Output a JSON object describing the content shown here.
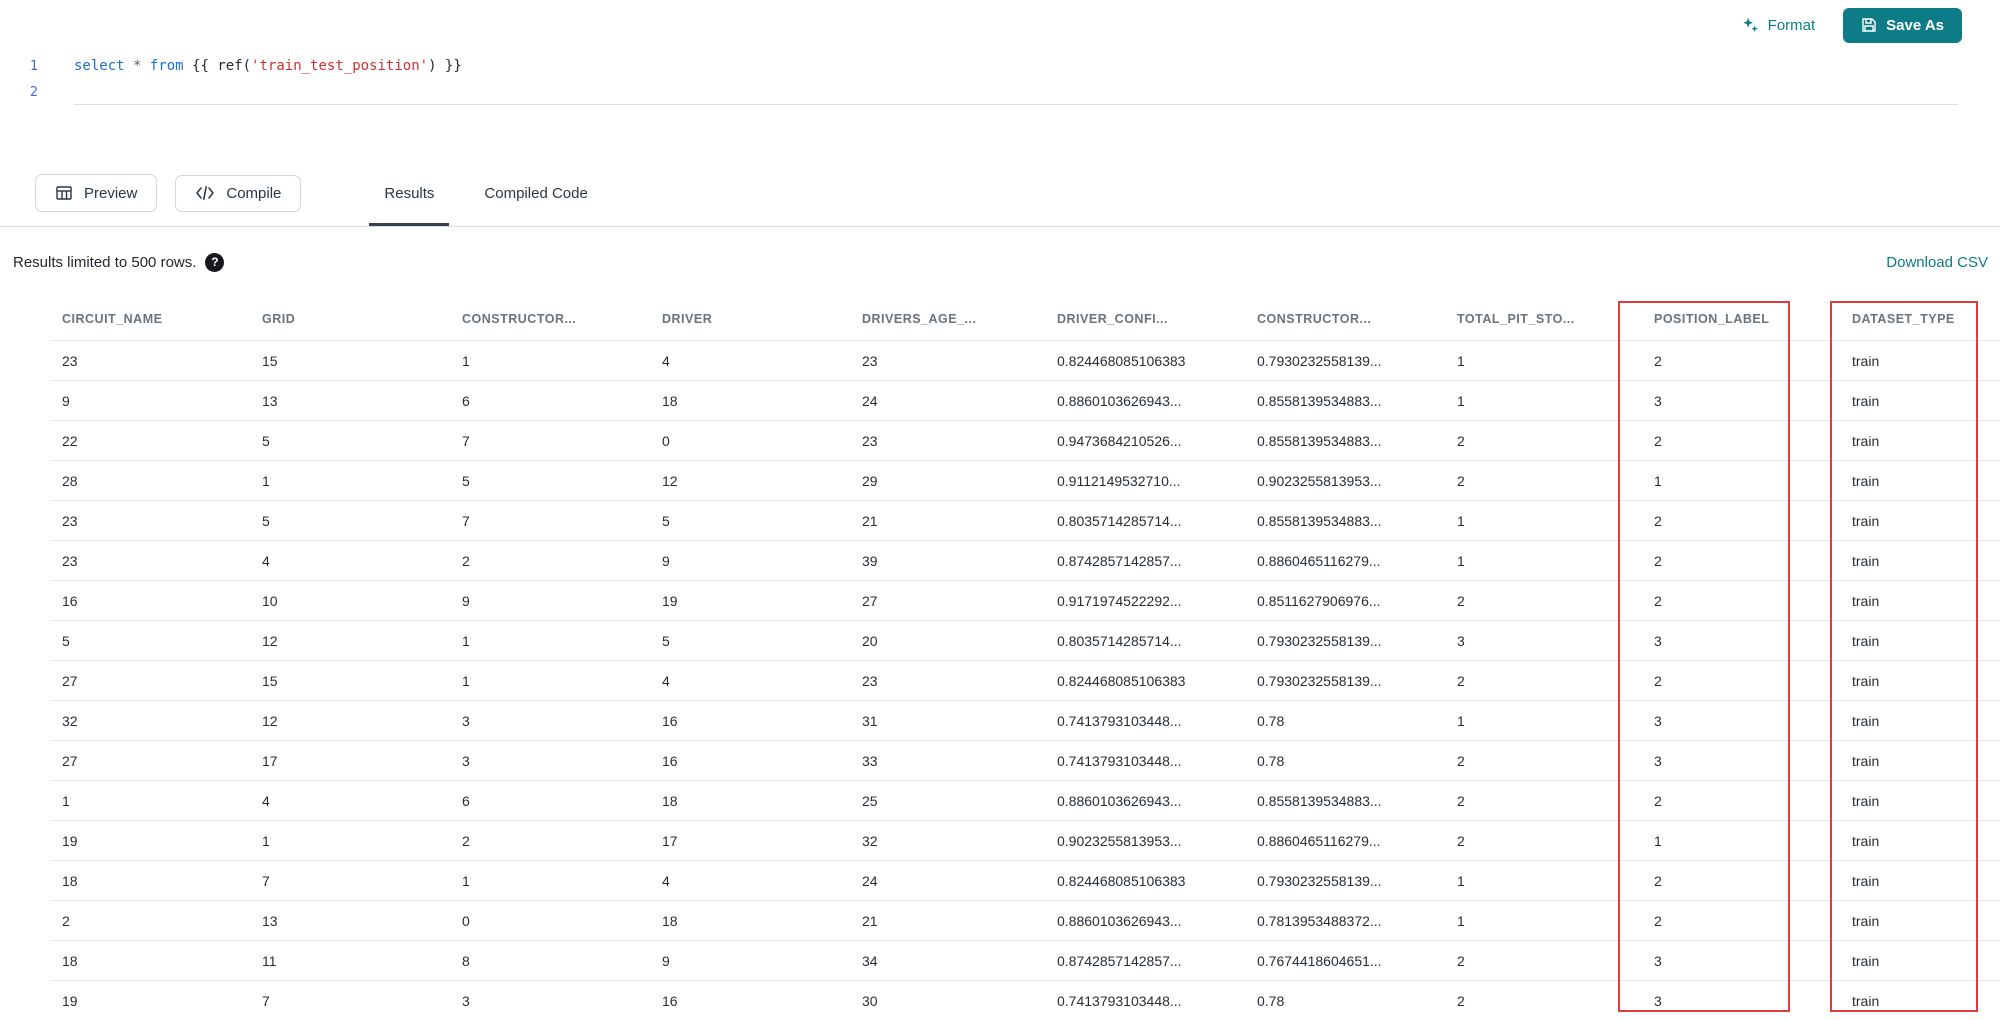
{
  "toolbar": {
    "format_label": "Format",
    "save_as_label": "Save As"
  },
  "editor": {
    "line_numbers": [
      "1",
      "2"
    ],
    "tokens": [
      {
        "text": "select",
        "type": "keyword"
      },
      {
        "text": " ",
        "type": "plain"
      },
      {
        "text": "*",
        "type": "operator"
      },
      {
        "text": " ",
        "type": "plain"
      },
      {
        "text": "from",
        "type": "keyword"
      },
      {
        "text": " {{ ",
        "type": "plain"
      },
      {
        "text": "ref(",
        "type": "plain"
      },
      {
        "text": "'train_test_position'",
        "type": "string"
      },
      {
        "text": ") }}",
        "type": "plain"
      }
    ]
  },
  "actions": {
    "preview_label": "Preview",
    "compile_label": "Compile"
  },
  "tabs": [
    {
      "label": "Results",
      "active": true
    },
    {
      "label": "Compiled Code",
      "active": false
    }
  ],
  "results_bar": {
    "limit_text": "Results limited to 500 rows.",
    "help_glyph": "?",
    "download_label": "Download CSV"
  },
  "table": {
    "columns": [
      "CIRCUIT_NAME",
      "GRID",
      "CONSTRUCTOR...",
      "DRIVER",
      "DRIVERS_AGE_...",
      "DRIVER_CONFI...",
      "CONSTRUCTOR...",
      "TOTAL_PIT_STO...",
      "POSITION_LABEL",
      "DATASET_TYPE"
    ],
    "rows": [
      [
        "23",
        "15",
        "1",
        "4",
        "23",
        "0.824468085106383",
        "0.7930232558139...",
        "1",
        "2",
        "train"
      ],
      [
        "9",
        "13",
        "6",
        "18",
        "24",
        "0.8860103626943...",
        "0.8558139534883...",
        "1",
        "3",
        "train"
      ],
      [
        "22",
        "5",
        "7",
        "0",
        "23",
        "0.9473684210526...",
        "0.8558139534883...",
        "2",
        "2",
        "train"
      ],
      [
        "28",
        "1",
        "5",
        "12",
        "29",
        "0.9112149532710...",
        "0.9023255813953...",
        "2",
        "1",
        "train"
      ],
      [
        "23",
        "5",
        "7",
        "5",
        "21",
        "0.8035714285714...",
        "0.8558139534883...",
        "1",
        "2",
        "train"
      ],
      [
        "23",
        "4",
        "2",
        "9",
        "39",
        "0.8742857142857...",
        "0.8860465116279...",
        "1",
        "2",
        "train"
      ],
      [
        "16",
        "10",
        "9",
        "19",
        "27",
        "0.9171974522292...",
        "0.8511627906976...",
        "2",
        "2",
        "train"
      ],
      [
        "5",
        "12",
        "1",
        "5",
        "20",
        "0.8035714285714...",
        "0.7930232558139...",
        "3",
        "3",
        "train"
      ],
      [
        "27",
        "15",
        "1",
        "4",
        "23",
        "0.824468085106383",
        "0.7930232558139...",
        "2",
        "2",
        "train"
      ],
      [
        "32",
        "12",
        "3",
        "16",
        "31",
        "0.7413793103448...",
        "0.78",
        "1",
        "3",
        "train"
      ],
      [
        "27",
        "17",
        "3",
        "16",
        "33",
        "0.7413793103448...",
        "0.78",
        "2",
        "3",
        "train"
      ],
      [
        "1",
        "4",
        "6",
        "18",
        "25",
        "0.8860103626943...",
        "0.8558139534883...",
        "2",
        "2",
        "train"
      ],
      [
        "19",
        "1",
        "2",
        "17",
        "32",
        "0.9023255813953...",
        "0.8860465116279...",
        "2",
        "1",
        "train"
      ],
      [
        "18",
        "7",
        "1",
        "4",
        "24",
        "0.824468085106383",
        "0.7930232558139...",
        "1",
        "2",
        "train"
      ],
      [
        "2",
        "13",
        "0",
        "18",
        "21",
        "0.8860103626943...",
        "0.7813953488372...",
        "1",
        "2",
        "train"
      ],
      [
        "18",
        "11",
        "8",
        "9",
        "34",
        "0.8742857142857...",
        "0.7674418604651...",
        "2",
        "3",
        "train"
      ],
      [
        "19",
        "7",
        "3",
        "16",
        "30",
        "0.7413793103448...",
        "0.78",
        "2",
        "3",
        "train"
      ]
    ]
  },
  "colors": {
    "accent_teal": "#0E7C86",
    "highlight_red": "#e23b3b"
  }
}
